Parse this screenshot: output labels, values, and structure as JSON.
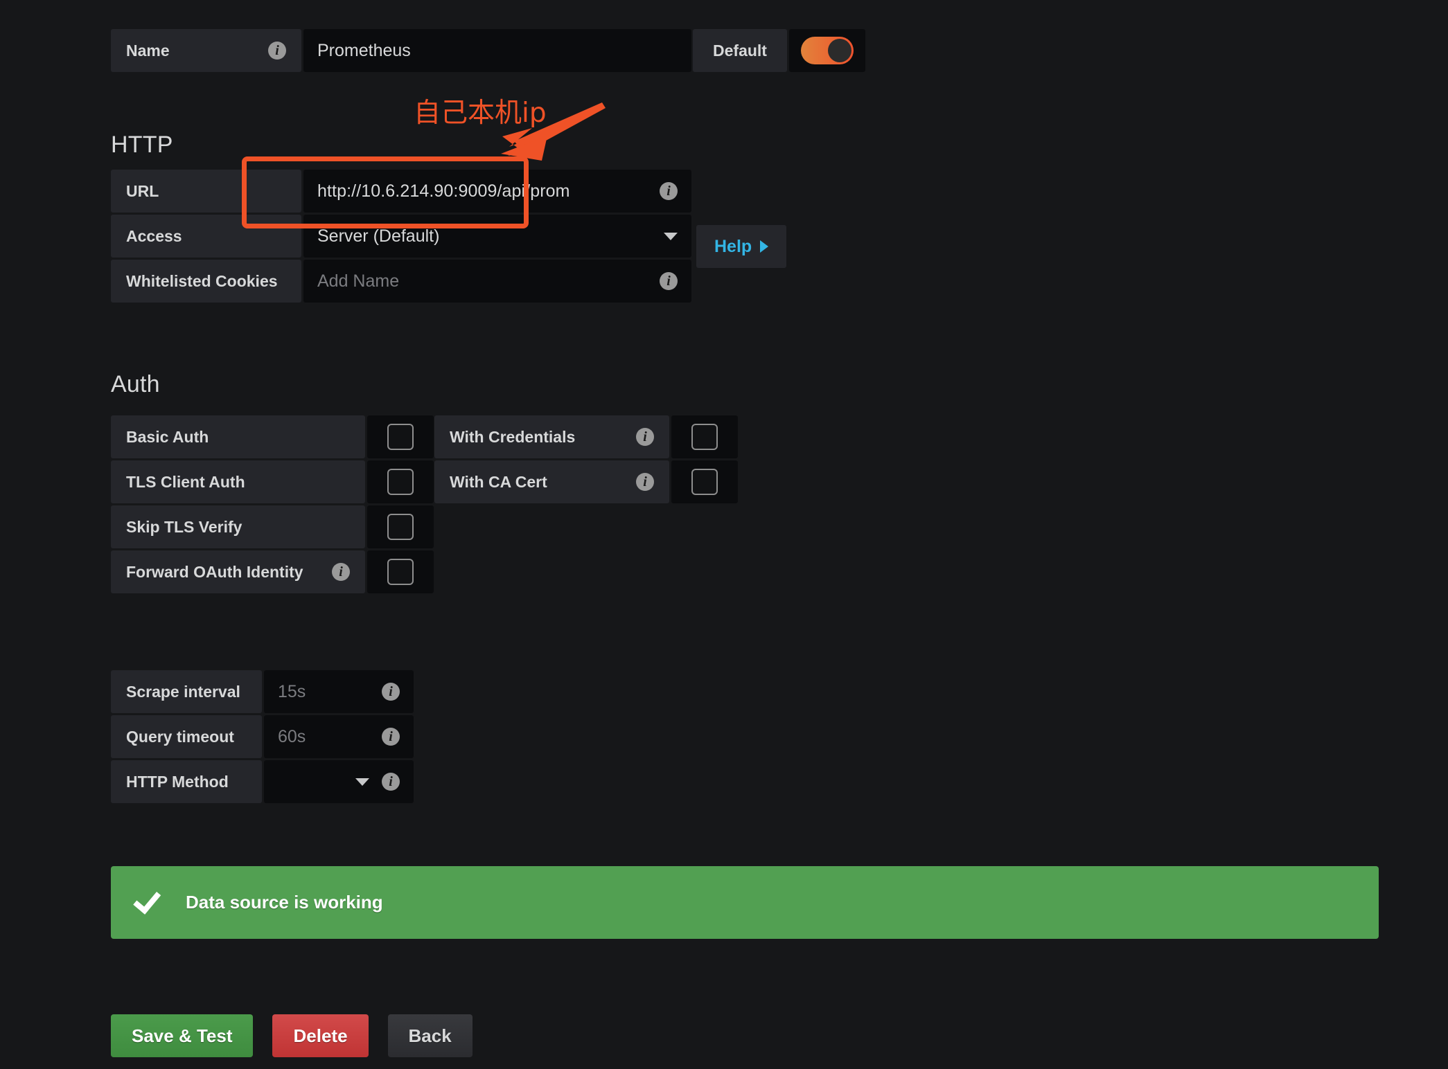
{
  "name_row": {
    "label": "Name",
    "info_icon": "info-icon",
    "value": "Prometheus"
  },
  "default_toggle": {
    "label": "Default",
    "state": "on",
    "accent_color": "#ef522d"
  },
  "http": {
    "section_title": "HTTP",
    "rows": [
      {
        "label": "URL",
        "value": "http://10.6.214.90:9009/api/prom",
        "is_placeholder": false,
        "info_icon": "info-icon"
      },
      {
        "label": "Access",
        "value": "Server (Default)",
        "is_placeholder": false,
        "caret_icon": "chevron-down-icon"
      },
      {
        "label": "Whitelisted Cookies",
        "value": "Add Name",
        "is_placeholder": true,
        "info_icon": "info-icon"
      }
    ],
    "help_button": {
      "label": "Help",
      "icon": "caret-right-icon",
      "color": "#33b5e5"
    }
  },
  "auth": {
    "section_title": "Auth",
    "left_column": [
      {
        "label": "Basic Auth",
        "checked": false,
        "has_info": false
      },
      {
        "label": "TLS Client Auth",
        "checked": false,
        "has_info": false
      },
      {
        "label": "Skip TLS Verify",
        "checked": false,
        "has_info": false
      },
      {
        "label": "Forward OAuth Identity",
        "checked": false,
        "has_info": true
      }
    ],
    "right_column": [
      {
        "label": "With Credentials",
        "checked": false,
        "has_info": true
      },
      {
        "label": "With CA Cert",
        "checked": false,
        "has_info": true
      }
    ]
  },
  "intervals": {
    "rows": [
      {
        "label": "Scrape interval",
        "value": "15s",
        "is_placeholder": true,
        "control": "text"
      },
      {
        "label": "Query timeout",
        "value": "60s",
        "is_placeholder": true,
        "control": "text"
      },
      {
        "label": "HTTP Method",
        "value": "",
        "is_placeholder": false,
        "control": "select"
      }
    ]
  },
  "status": {
    "message": "Data source is working",
    "icon": "check-icon",
    "background_color": "#52a052"
  },
  "buttons": {
    "save": "Save & Test",
    "delete": "Delete",
    "back": "Back"
  },
  "annotation": {
    "text": "自己本机ip",
    "color": "#ef5227",
    "arrow_icon": "arrow-pointing-down-left-icon",
    "highlight_box": "url-field-highlight"
  }
}
